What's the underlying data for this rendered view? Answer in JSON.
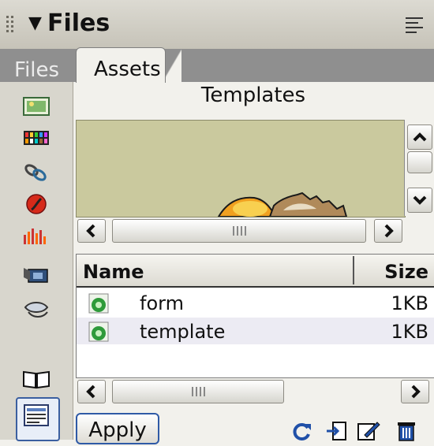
{
  "panel": {
    "title": "Files"
  },
  "tabs": [
    {
      "label": "Files",
      "active": false
    },
    {
      "label": "Assets",
      "active": true
    }
  ],
  "assets": {
    "category_title": "Templates",
    "left_icons": [
      "images-icon",
      "colors-icon",
      "urls-icon",
      "flash-icon",
      "shockwave-icon",
      "movies-icon",
      "scripts-icon",
      "templates-icon",
      "library-icon"
    ],
    "selected_category": "templates-icon"
  },
  "list": {
    "columns": {
      "name": "Name",
      "size": "Size"
    },
    "rows": [
      {
        "name": "form",
        "size": "1KB"
      },
      {
        "name": "template",
        "size": "1KB"
      }
    ]
  },
  "toolbar": {
    "apply_label": "Apply"
  },
  "colors": {
    "preview_bg": "#cac99e",
    "tab_strip": "#8f8f8f",
    "accent": "#2f5aa6"
  }
}
